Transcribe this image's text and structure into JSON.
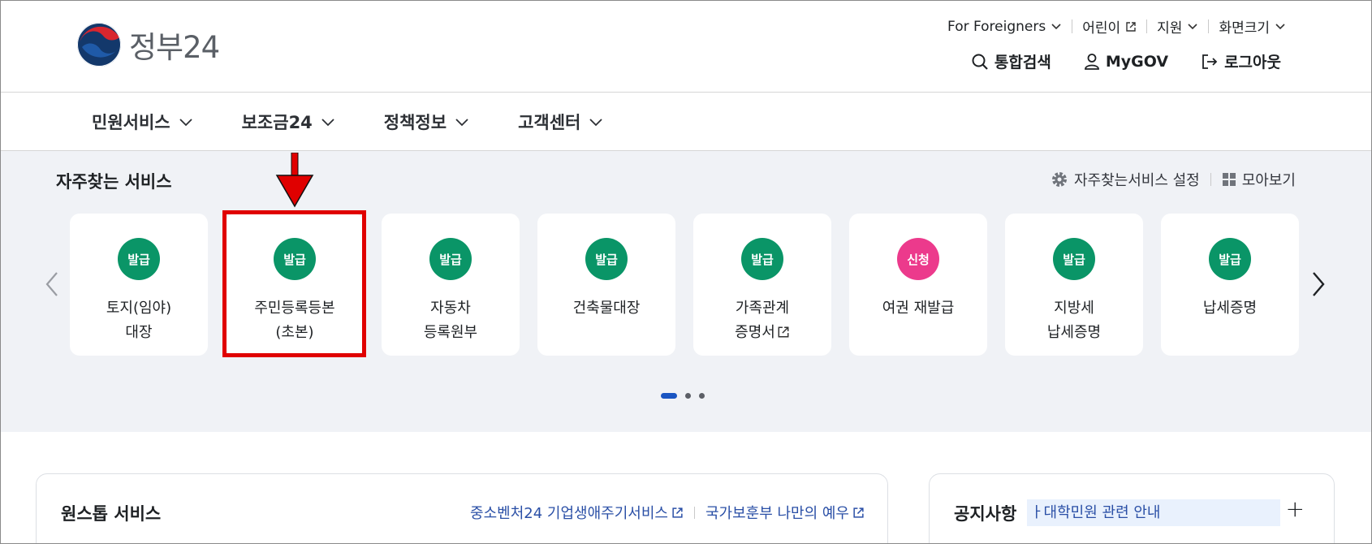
{
  "header": {
    "logo_text": "정부24",
    "util": [
      {
        "label": "For Foreigners",
        "icon": "chevron-down-icon"
      },
      {
        "label": "어린이",
        "icon": "external-link-icon"
      },
      {
        "label": "지원",
        "icon": "chevron-down-icon"
      },
      {
        "label": "화면크기",
        "icon": "chevron-down-icon"
      }
    ],
    "actions": [
      {
        "label": "통합검색",
        "icon": "search-icon"
      },
      {
        "label": "MyGOV",
        "icon": "user-icon"
      },
      {
        "label": "로그아웃",
        "icon": "logout-icon"
      }
    ]
  },
  "gnb": [
    "민원서비스",
    "보조금24",
    "정책정보",
    "고객센터"
  ],
  "favorites": {
    "title": "자주찾는 서비스",
    "settings_label": "자주찾는서비스 설정",
    "view_all_label": "모아보기",
    "cards": [
      {
        "badge": "발급",
        "label": "토지(임야)\n대장",
        "type": "issue"
      },
      {
        "badge": "발급",
        "label": "주민등록등본\n(초본)",
        "type": "issue"
      },
      {
        "badge": "발급",
        "label": "자동차\n등록원부",
        "type": "issue"
      },
      {
        "badge": "발급",
        "label": "건축물대장",
        "type": "issue"
      },
      {
        "badge": "발급",
        "label": "가족관계\n증명서",
        "type": "issue",
        "external": true
      },
      {
        "badge": "신청",
        "label": "여권 재발급",
        "type": "apply"
      },
      {
        "badge": "발급",
        "label": "지방세\n납세증명",
        "type": "issue"
      },
      {
        "badge": "발급",
        "label": "납세증명",
        "type": "issue"
      }
    ],
    "pagination": {
      "pages": 3,
      "current": 1
    }
  },
  "onestop": {
    "title": "원스톱 서비스",
    "links": [
      "중소벤처24 기업생애주기서비스",
      "국가보훈부 나만의 예우"
    ]
  },
  "notice": {
    "title": "공지사항",
    "text": "ㅏ대학민원 관련 안내",
    "more": "+"
  },
  "colors": {
    "issue_badge": "#0a9567",
    "apply_badge": "#ec3a8c",
    "highlight": "#e00000",
    "link": "#2a4fa6",
    "section_bg": "#f0f2f6"
  }
}
